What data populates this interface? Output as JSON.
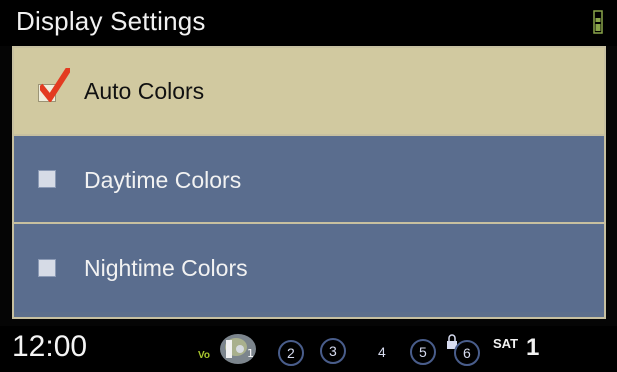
{
  "header": {
    "title": "Display Settings",
    "status_icon": "battery-signal-icon"
  },
  "menu": {
    "items": [
      {
        "label": "Auto Colors",
        "selected": true
      },
      {
        "label": "Daytime Colors",
        "selected": false
      },
      {
        "label": "Nightime Colors",
        "selected": false
      }
    ]
  },
  "status_bar": {
    "time": "12:00",
    "mini_text": "Vo",
    "preset_numbers": [
      "2",
      "3",
      "4",
      "5",
      "6"
    ],
    "sat_label": "SAT",
    "channel": "1",
    "icons": {
      "active_source": "disc-media-icon",
      "presets": "preset-circle-icon",
      "lock": "lock-icon"
    }
  },
  "colors": {
    "selected_row": "#d1c9a0",
    "normal_row": "#5a6d8e",
    "accent_check": "#e33b21",
    "border": "#c7c0a0"
  }
}
